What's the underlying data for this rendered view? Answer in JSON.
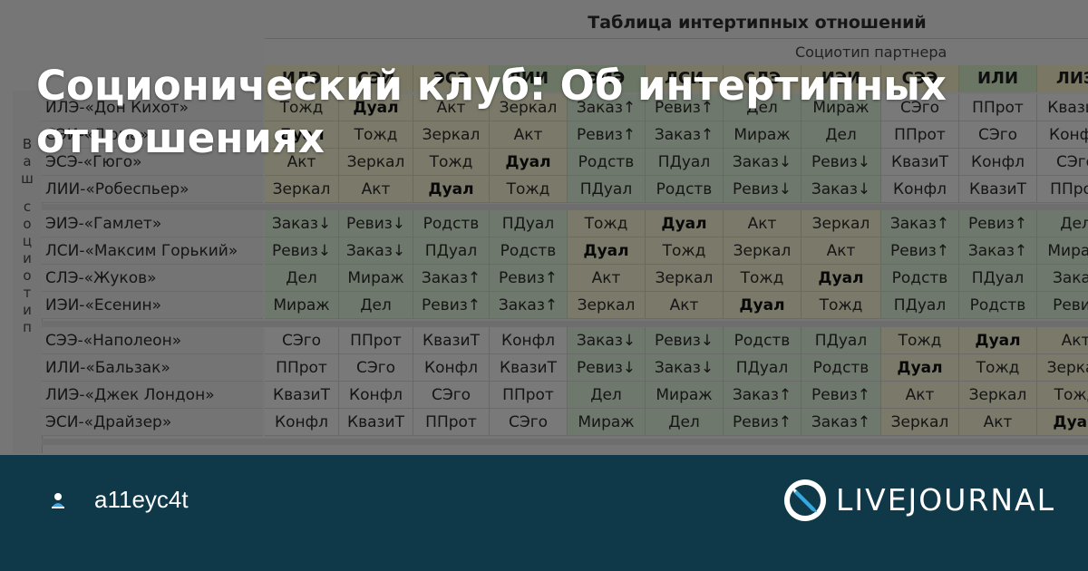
{
  "post": {
    "title": "Соционический клуб: Об интертипных отношениях"
  },
  "author": {
    "username": "a11eyc4t",
    "icon": "user-icon"
  },
  "brand": {
    "name": "LIVEJOURNAL",
    "icon": "livejournal-logo-icon",
    "footer_color": "#0f3848"
  },
  "table": {
    "title": "Таблица интертипных отношений",
    "partner_header": "Социотип партнера",
    "side_label": "Ваш социотип",
    "col_headers": [
      "ИЛЭ",
      "СЭИ",
      "ЭСЭ",
      "ЛИИ",
      "ЭИЭ",
      "ЛСИ",
      "СЛЭ",
      "ИЭИ",
      "СЭЭ",
      "ИЛИ",
      "ЛИЭ"
    ],
    "rows": [
      {
        "label": "ИЛЭ-«Дон Кихот»",
        "cells": [
          "Тожд",
          "Дуал",
          "Акт",
          "Зеркал",
          "Заказ↑",
          "Ревиз↑",
          "Дел",
          "Мираж",
          "СЭго",
          "ППрот",
          "Квазит"
        ]
      },
      {
        "label": "СЭИ-«Дюма»",
        "cells": [
          "Дуал",
          "Тожд",
          "Зеркал",
          "Акт",
          "Ревиз↑",
          "Заказ↑",
          "Мираж",
          "Дел",
          "ППрот",
          "СЭго",
          "Конфл"
        ]
      },
      {
        "label": "ЭСЭ-«Гюго»",
        "cells": [
          "Акт",
          "Зеркал",
          "Тожд",
          "Дуал",
          "Родств",
          "ПДуал",
          "Заказ↓",
          "Ревиз↓",
          "КвазиТ",
          "Конфл",
          "СЭго"
        ]
      },
      {
        "label": "ЛИИ-«Робеспьер»",
        "cells": [
          "Зеркал",
          "Акт",
          "Дуал",
          "Тожд",
          "ПДуал",
          "Родств",
          "Ревиз↓",
          "Заказ↓",
          "Конфл",
          "КвазиТ",
          "ППрот"
        ]
      },
      {
        "label": "ЭИЭ-«Гамлет»",
        "cells": [
          "Заказ↓",
          "Ревиз↓",
          "Родств",
          "ПДуал",
          "Тожд",
          "Дуал",
          "Акт",
          "Зеркал",
          "Заказ↑",
          "Ревиз↑",
          "Дел"
        ]
      },
      {
        "label": "ЛСИ-«Максим Горький»",
        "cells": [
          "Ревиз↓",
          "Заказ↓",
          "ПДуал",
          "Родств",
          "Дуал",
          "Тожд",
          "Зеркал",
          "Акт",
          "Ревиз↑",
          "Заказ↑",
          "Мираж"
        ]
      },
      {
        "label": "СЛЭ-«Жуков»",
        "cells": [
          "Дел",
          "Мираж",
          "Заказ↑",
          "Ревиз↑",
          "Акт",
          "Зеркал",
          "Тожд",
          "Дуал",
          "Родств",
          "ПДуал",
          "Заказ"
        ]
      },
      {
        "label": "ИЭИ-«Есенин»",
        "cells": [
          "Мираж",
          "Дел",
          "Ревиз↑",
          "Заказ↑",
          "Зеркал",
          "Акт",
          "Дуал",
          "Тожд",
          "ПДуал",
          "Родств",
          "Ревиз"
        ]
      },
      {
        "label": "СЭЭ-«Наполеон»",
        "cells": [
          "СЭго",
          "ППрот",
          "КвазиТ",
          "Конфл",
          "Заказ↓",
          "Ревиз↓",
          "Родств",
          "ПДуал",
          "Тожд",
          "Дуал",
          "Акт"
        ]
      },
      {
        "label": "ИЛИ-«Бальзак»",
        "cells": [
          "ППрот",
          "СЭго",
          "Конфл",
          "КвазиТ",
          "Ревиз↓",
          "Заказ↓",
          "ПДуал",
          "Родств",
          "Дуал",
          "Тожд",
          "Зеркал"
        ]
      },
      {
        "label": "ЛИЭ-«Джек Лондон»",
        "cells": [
          "КвазиТ",
          "Конфл",
          "СЭго",
          "ППрот",
          "Дел",
          "Мираж",
          "Заказ↑",
          "Ревиз↑",
          "Акт",
          "Зеркал",
          "Тожд"
        ]
      },
      {
        "label": "ЭСИ-«Драйзер»",
        "cells": [
          "Конфл",
          "КвазиТ",
          "ППрот",
          "СЭго",
          "Мираж",
          "Дел",
          "Ревиз↑",
          "Заказ↑",
          "Зеркал",
          "Акт",
          "Дуал"
        ]
      }
    ],
    "colors": {
      "cell_default": "#f2f2f2",
      "cell_green": "#dff0d8",
      "cell_yellow": "#f7f3d2",
      "header_yellow": "#f5f0c8",
      "header_green": "#d6ecc9"
    }
  }
}
